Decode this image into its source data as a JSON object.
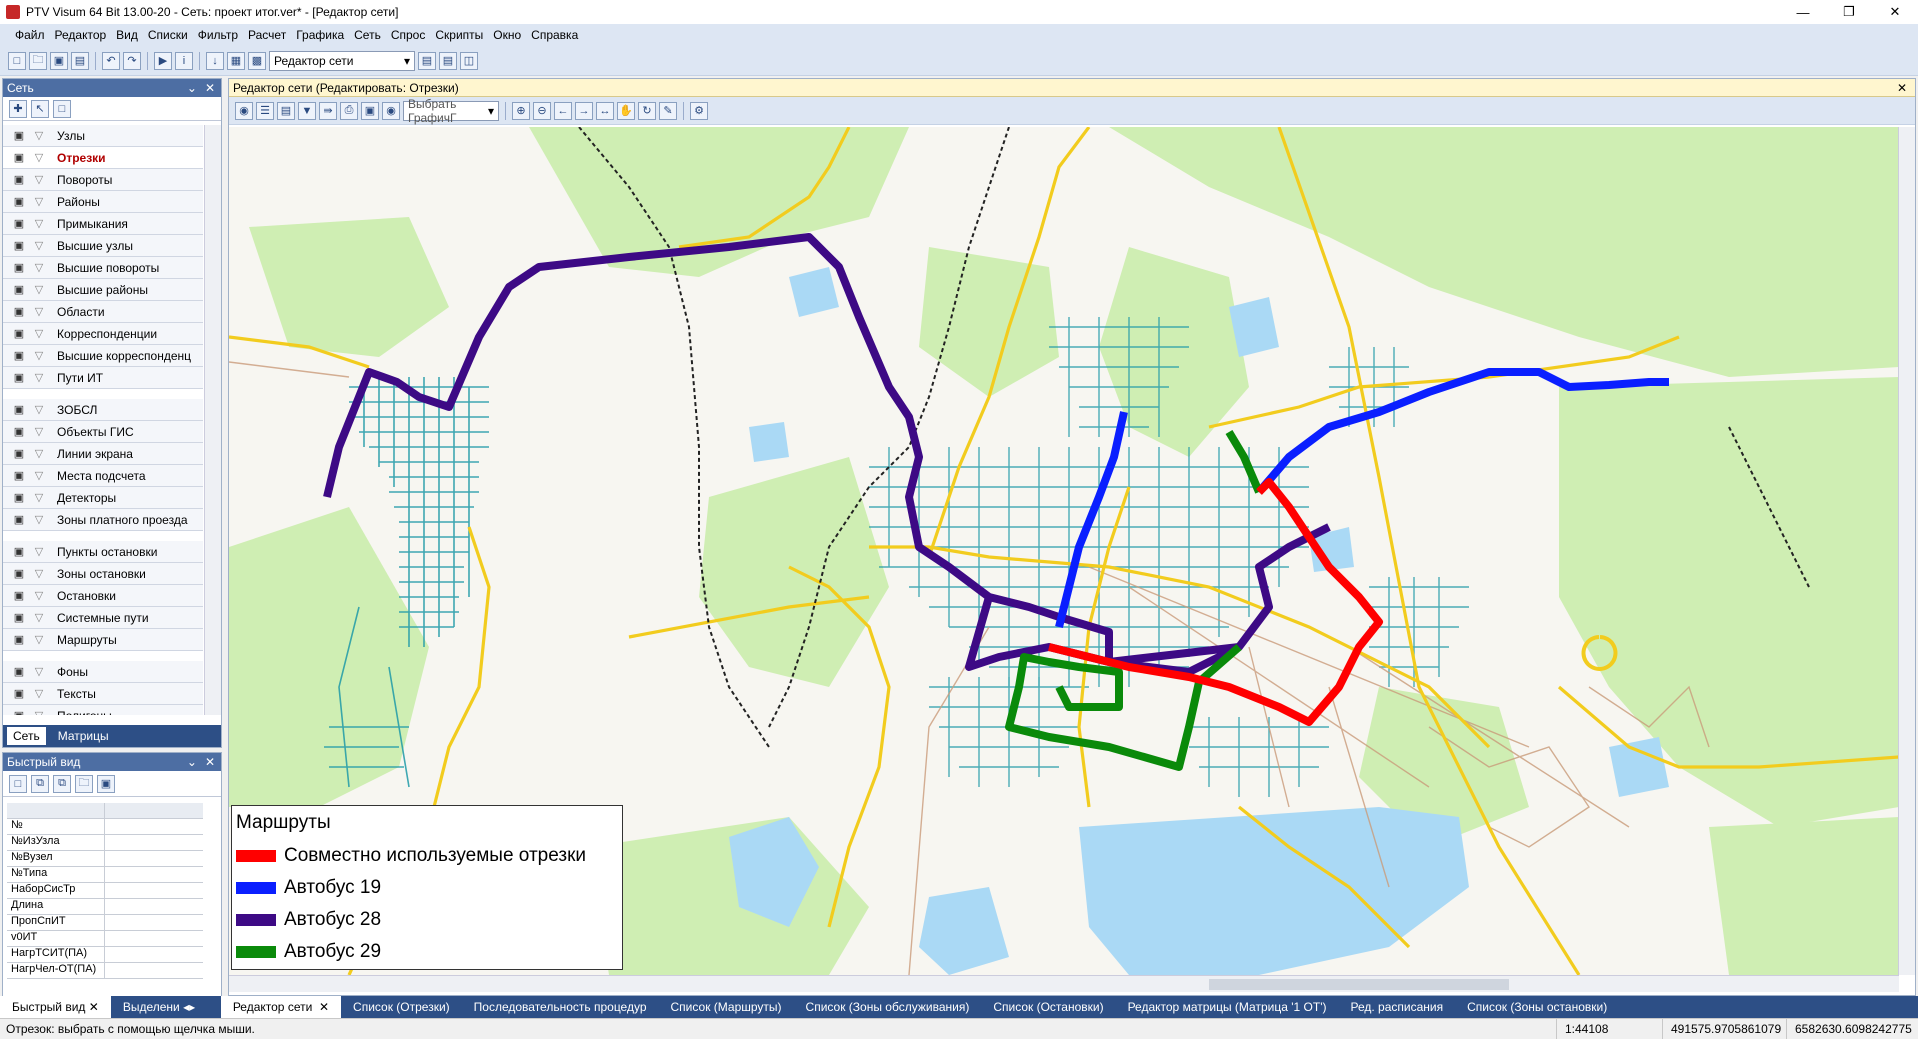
{
  "window": {
    "title": "PTV Visum 64 Bit 13.00-20 - Сеть: проект итог.ver* - [Редактор сети]"
  },
  "menu": [
    "Файл",
    "Редактор",
    "Вид",
    "Списки",
    "Фильтр",
    "Расчет",
    "Графика",
    "Сеть",
    "Спрос",
    "Скрипты",
    "Окно",
    "Справка"
  ],
  "toolbar": {
    "view_combo": "Редактор сети"
  },
  "net_panel": {
    "title": "Сеть",
    "items": [
      {
        "label": "Узлы",
        "icon": "node-icon"
      },
      {
        "label": "Отрезки",
        "icon": "link-icon",
        "selected": true
      },
      {
        "label": "Повороты",
        "icon": "turn-icon"
      },
      {
        "label": "Районы",
        "icon": "zone-icon"
      },
      {
        "label": "Примыкания",
        "icon": "connector-icon"
      },
      {
        "label": "Высшие узлы",
        "icon": "main-node-icon"
      },
      {
        "label": "Высшие повороты",
        "icon": "main-turn-icon"
      },
      {
        "label": "Высшие районы",
        "icon": "main-zone-icon"
      },
      {
        "label": "Области",
        "icon": "territory-icon"
      },
      {
        "label": "Корреспонденции",
        "icon": "od-pair-icon"
      },
      {
        "label": "Высшие корреспонденц",
        "icon": "main-od-icon"
      },
      {
        "label": "Пути ИТ",
        "icon": "path-icon"
      },
      {
        "label": "ЗОБСЛ",
        "icon": "poi-icon"
      },
      {
        "label": "Объекты ГИС",
        "icon": "gis-icon"
      },
      {
        "label": "Линии экрана",
        "icon": "screenline-icon"
      },
      {
        "label": "Места подсчета",
        "icon": "count-location-icon"
      },
      {
        "label": "Детекторы",
        "icon": "detector-icon"
      },
      {
        "label": "Зоны платного проезда",
        "icon": "toll-icon"
      },
      {
        "label": "Пункты остановки",
        "icon": "stop-point-icon"
      },
      {
        "label": "Зоны остановки",
        "icon": "stop-area-icon"
      },
      {
        "label": "Остановки",
        "icon": "stop-icon"
      },
      {
        "label": "Системные пути",
        "icon": "system-route-icon"
      },
      {
        "label": "Маршруты",
        "icon": "line-icon"
      },
      {
        "label": "Фоны",
        "icon": "background-icon"
      },
      {
        "label": "Тексты",
        "icon": "text-icon"
      },
      {
        "label": "Полигоны",
        "icon": "polygon-icon"
      }
    ],
    "tabs": [
      "Сеть",
      "Матрицы"
    ]
  },
  "quick_view": {
    "title": "Быстрый вид",
    "rows": [
      "№",
      "№ИзУзла",
      "№Вузел",
      "№Типа",
      "НаборСисТр",
      "Длина",
      "ПропСпИТ",
      "v0ИТ",
      "НагрТСИТ(ПА)",
      "НагрЧел-ОТ(ПА)"
    ]
  },
  "editor": {
    "title": "Редактор сети (Редактировать: Отрезки)",
    "graphic_combo": "Выбрать ГрафичГ"
  },
  "legend": {
    "title": "Маршруты",
    "entries": [
      {
        "label": "Совместно используемые отрезки",
        "color": "#ff0000"
      },
      {
        "label": "Автобус 19",
        "color": "#0a1fff"
      },
      {
        "label": "Автобус 28",
        "color": "#3d0a85"
      },
      {
        "label": "Автобус 29",
        "color": "#0a8a0a"
      }
    ]
  },
  "bottom_tabs_left": [
    "Быстрый вид",
    "Выделени"
  ],
  "bottom_tabs": [
    "Редактор сети",
    "Список (Отрезки)",
    "Последовательность процедур",
    "Список (Маршруты)",
    "Список (Зоны обслуживания)",
    "Список (Остановки)",
    "Редактор матрицы (Матрица '1 ОТ')",
    "Ред. расписания",
    "Список (Зоны остановки)"
  ],
  "status": {
    "message": "Отрезок: выбрать с помощью щелчка мыши.",
    "scale": "1:44108",
    "x": "491575.9705861079",
    "y": "6582630.6098242775"
  }
}
